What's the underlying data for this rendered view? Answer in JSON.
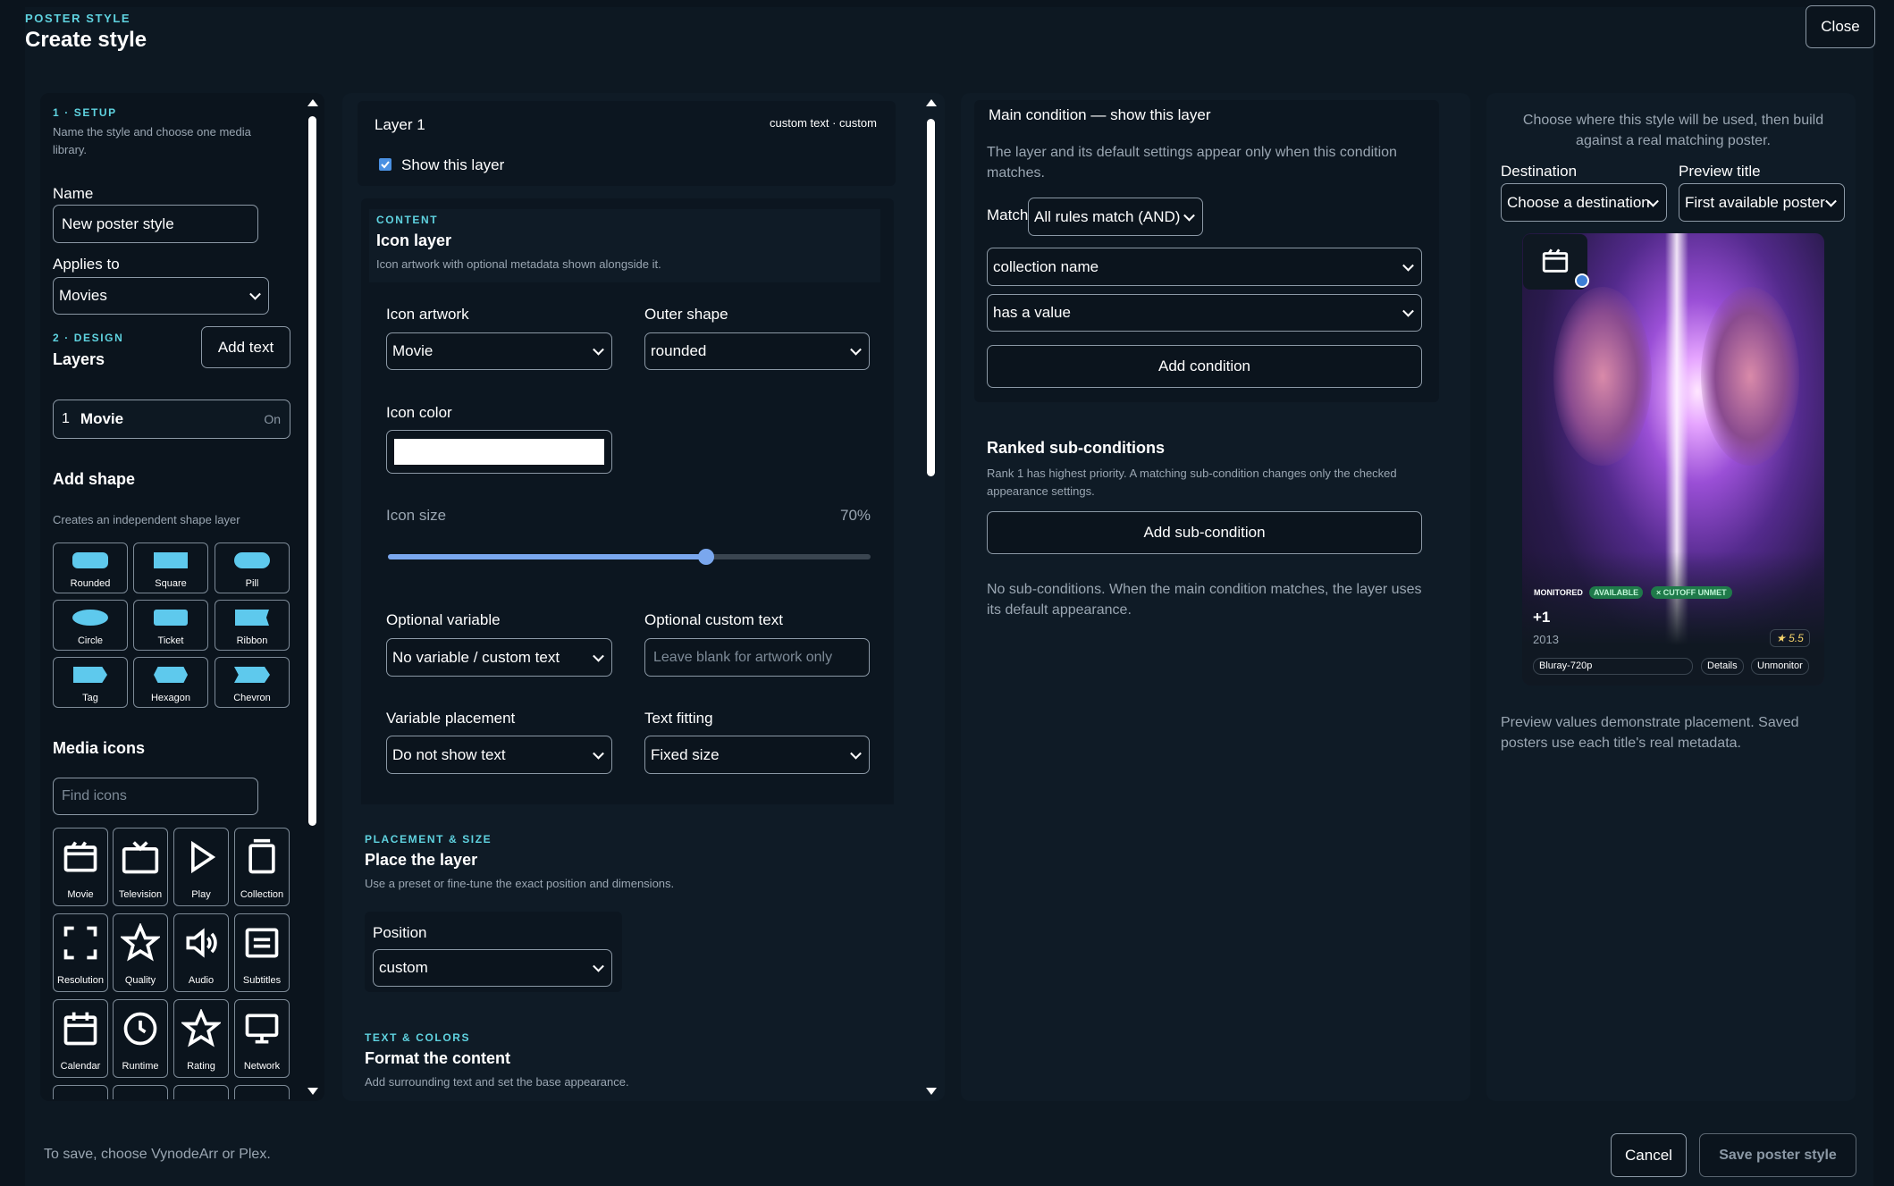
{
  "header": {
    "kicker": "POSTER STYLE",
    "title": "Create style",
    "close_label": "Close"
  },
  "setup": {
    "kicker": "1 · SETUP",
    "desc": "Name the style and choose one media library.",
    "name_label": "Name",
    "name_value": "New poster style",
    "applies_label": "Applies to",
    "applies_value": "Movies"
  },
  "design": {
    "kicker": "2 · DESIGN",
    "layers_title": "Layers",
    "add_text_label": "Add text",
    "layer_item": {
      "index": "1",
      "name": "Movie",
      "state": "On"
    },
    "add_shape_title": "Add shape",
    "add_shape_desc": "Creates an independent shape layer",
    "shapes": [
      "Rounded",
      "Square",
      "Pill",
      "Circle",
      "Ticket",
      "Ribbon",
      "Tag",
      "Hexagon",
      "Chevron"
    ],
    "media_icons_title": "Media icons",
    "find_icons_placeholder": "Find icons",
    "icons": [
      "Movie",
      "Television",
      "Play",
      "Collection",
      "Resolution",
      "Quality",
      "Audio",
      "Subtitles",
      "Calendar",
      "Runtime",
      "Rating",
      "Network"
    ]
  },
  "layer": {
    "title": "Layer 1",
    "meta": "custom text · custom",
    "show_label": "Show this layer",
    "content_kicker": "CONTENT",
    "content_title": "Icon layer",
    "content_desc": "Icon artwork with optional metadata shown alongside it.",
    "artwork_label": "Icon artwork",
    "artwork_value": "Movie",
    "outer_label": "Outer shape",
    "outer_value": "rounded",
    "color_label": "Icon color",
    "icon_color": "#ffffff",
    "size_label": "Icon size",
    "size_value": "70%",
    "size_fraction": 0.66,
    "var_label": "Optional variable",
    "var_value": "No variable / custom text",
    "custom_text_label": "Optional custom text",
    "custom_text_placeholder": "Leave blank for artwork only",
    "placement_label": "Variable placement",
    "placement_value": "Do not show text",
    "fitting_label": "Text fitting",
    "fitting_value": "Fixed size",
    "place_kicker": "PLACEMENT & SIZE",
    "place_title": "Place the layer",
    "place_desc": "Use a preset or fine-tune the exact position and dimensions.",
    "position_label": "Position",
    "position_value": "custom",
    "text_kicker": "TEXT & COLORS",
    "text_title": "Format the content",
    "text_desc": "Add surrounding text and set the base appearance."
  },
  "conditions": {
    "main_title": "Main condition — show this layer",
    "main_desc": "The layer and its default settings appear only when this condition matches.",
    "match_label": "Match",
    "match_value": "All rules match (AND)",
    "field_value": "collection name",
    "operator_value": "has a value",
    "add_condition_label": "Add condition",
    "ranked_title": "Ranked sub-conditions",
    "ranked_desc": "Rank 1 has highest priority. A matching sub-condition changes only the checked appearance settings.",
    "add_sub_label": "Add sub-condition",
    "empty_text": "No sub-conditions. When the main condition matches, the layer uses its default appearance."
  },
  "preview": {
    "intro": "Choose where this style will be used, then build against a real matching poster.",
    "destination_label": "Destination",
    "destination_value": "Choose a destination",
    "preview_title_label": "Preview title",
    "preview_title_value": "First available poster",
    "poster": {
      "monitored": "MONITORED",
      "available": "AVAILABLE",
      "cutoff": "× CUTOFF UNMET",
      "title": "+1",
      "year": "2013",
      "rating": "★ 5.5",
      "quality": "Bluray-720p",
      "details_label": "Details",
      "unmonitor_label": "Unmonitor"
    },
    "note": "Preview values demonstrate placement. Saved posters use each title's real metadata."
  },
  "footer": {
    "hint": "To save, choose VynodeArr or Plex.",
    "cancel_label": "Cancel",
    "save_label": "Save poster style"
  },
  "colors": {
    "accent": "#5fd3e0",
    "shape_fill": "#5ec9ed",
    "slider": "#7aa7ee",
    "badge_green": "#1f7a4a"
  }
}
